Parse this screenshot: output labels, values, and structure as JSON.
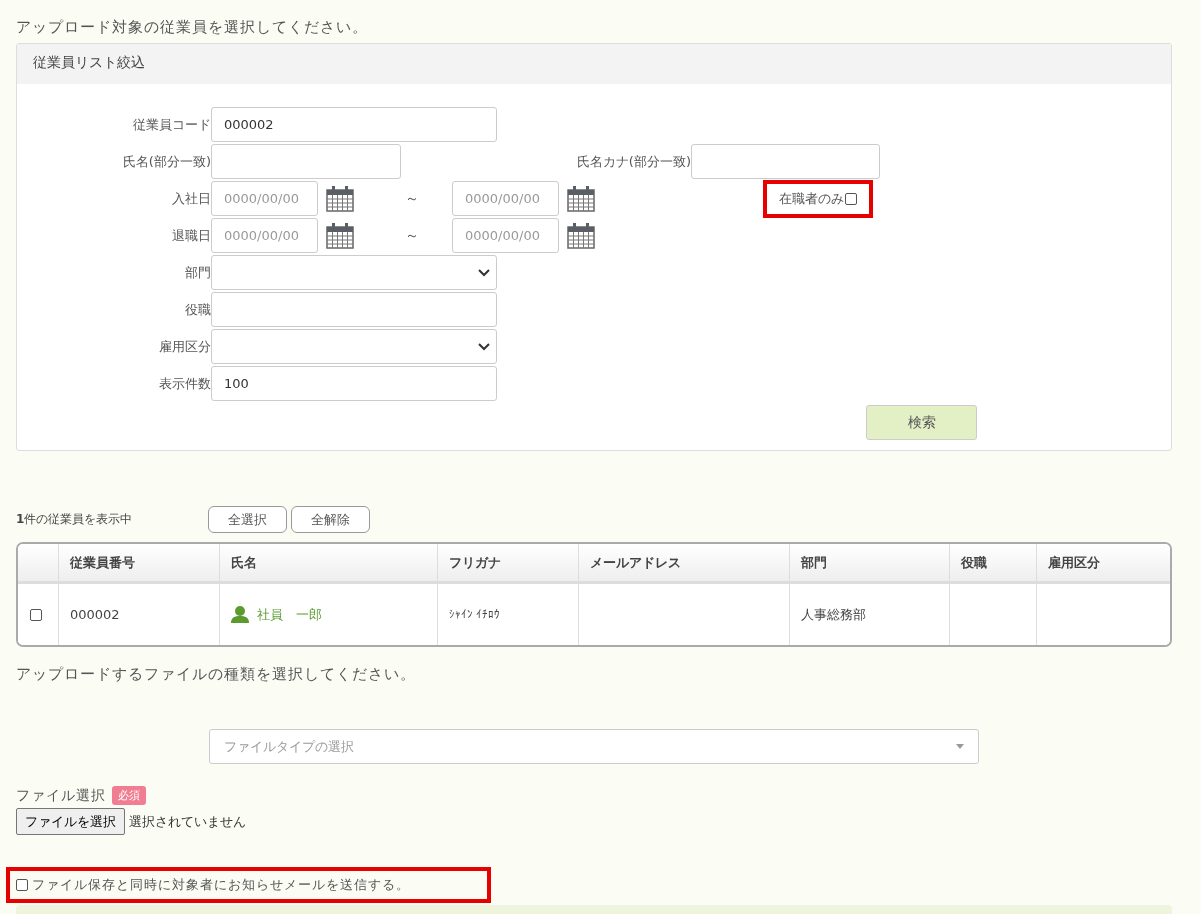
{
  "employee_section": {
    "instruction": "アップロード対象の従業員を選択してください。"
  },
  "filter_panel": {
    "title": "従業員リスト絞込",
    "code": {
      "label": "従業員コード",
      "value": "000002"
    },
    "name": {
      "label": "氏名(部分一致)"
    },
    "kana": {
      "label": "氏名カナ(部分一致)"
    },
    "date_rows": [
      {
        "label": "入社日",
        "from_placeholder": "0000/00/00",
        "separator": "～",
        "to_placeholder": "0000/00/00"
      },
      {
        "label": "退職日",
        "from_placeholder": "0000/00/00",
        "separator": "～",
        "to_placeholder": "0000/00/00"
      }
    ],
    "active_only": {
      "label": "在職者のみ",
      "checked": false,
      "highlighted": true
    },
    "lower_fields": [
      {
        "kind": "select",
        "label": "部門"
      },
      {
        "kind": "text",
        "label": "役職"
      },
      {
        "kind": "select",
        "label": "雇用区分"
      },
      {
        "kind": "text",
        "label": "表示件数",
        "value": "100"
      }
    ],
    "search_button": "検索"
  },
  "list": {
    "count": "1",
    "count_suffix": "件の従業員を表示中",
    "buttons": [
      "全選択",
      "全解除"
    ],
    "columns": [
      "従業員番号",
      "氏名",
      "フリガナ",
      "メールアドレス",
      "部門",
      "役職",
      "雇用区分"
    ],
    "rows": [
      {
        "checked": false,
        "number": "000002",
        "name": "社員　一郎",
        "kana": "ｼｬｲﾝ ｲﾁﾛｳ",
        "department": "人事総務部"
      }
    ]
  },
  "file_section": {
    "instruction": "アップロードするファイルの種類を選択してください。",
    "file_type_placeholder": "ファイルタイプの選択",
    "file_label": "ファイル選択",
    "required_badge": "必須",
    "choose_button": "ファイルを選択",
    "no_file_text": "選択されていません"
  },
  "notify": {
    "label": "ファイル保存と同時に対象者にお知らせメールを送信する。",
    "checked": false,
    "highlighted": true
  }
}
